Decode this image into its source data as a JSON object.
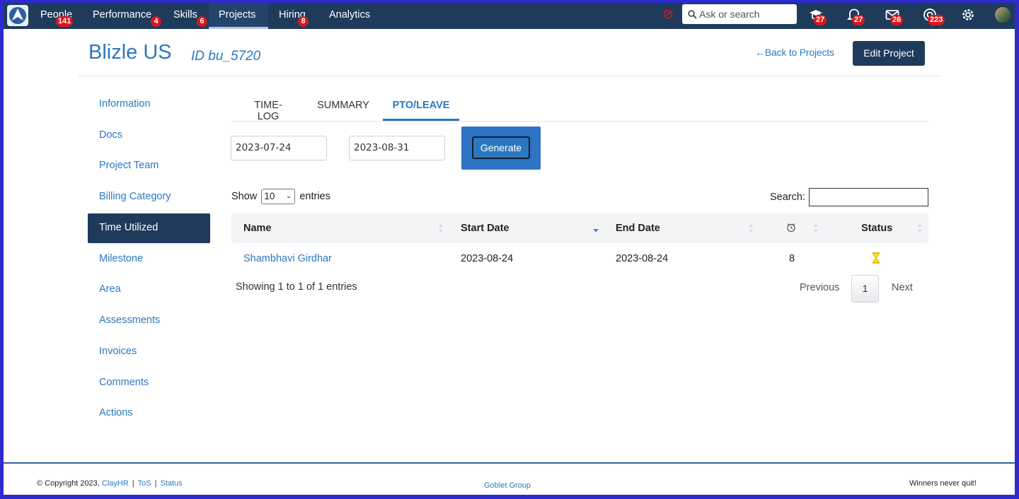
{
  "nav": {
    "items": [
      {
        "label": "People",
        "badge": "141"
      },
      {
        "label": "Performance",
        "badge": "4"
      },
      {
        "label": "Skills",
        "badge": "6"
      },
      {
        "label": "Projects",
        "badge": ""
      },
      {
        "label": "Hiring",
        "badge": "8"
      },
      {
        "label": "Analytics",
        "badge": ""
      }
    ],
    "search_placeholder": "Ask or search",
    "icons": [
      {
        "name": "graduation-cap-icon",
        "badge": "27"
      },
      {
        "name": "bell-icon",
        "badge": "27"
      },
      {
        "name": "mail-icon",
        "badge": "26"
      },
      {
        "name": "support-icon",
        "badge": "223"
      },
      {
        "name": "gear-icon",
        "badge": ""
      }
    ]
  },
  "header": {
    "title": "Blizle US",
    "id_text": "ID bu_5720",
    "back_link": "Back to Projects",
    "edit_button": "Edit Project"
  },
  "sidebar": {
    "items": [
      "Information",
      "Docs",
      "Project Team",
      "Billing Category",
      "Time Utilized",
      "Milestone",
      "Area",
      "Assessments",
      "Invoices",
      "Comments",
      "Actions"
    ],
    "active": "Time Utilized"
  },
  "tabs": {
    "items": [
      "TIME-LOG",
      "SUMMARY",
      "PTO/LEAVE"
    ],
    "active": "PTO/LEAVE"
  },
  "filters": {
    "start_date": "2023-07-24",
    "end_date": "2023-08-31",
    "generate_label": "Generate"
  },
  "table": {
    "show_label": "Show",
    "entries_label": "entries",
    "page_size": "10",
    "search_label": "Search:",
    "columns": [
      "Name",
      "Start Date",
      "End Date",
      "",
      "Status"
    ],
    "rows": [
      {
        "name": "Shambhavi Girdhar",
        "start": "2023-08-24",
        "end": "2023-08-24",
        "count": "8"
      }
    ],
    "showing": "Showing 1 to 1 of 1 entries",
    "prev": "Previous",
    "page": "1",
    "next": "Next"
  },
  "footer": {
    "copyright": "© Copyright 2023,",
    "brand": "ClayHR",
    "tos": "ToS",
    "status": "Status",
    "center": "Goblet Group",
    "right": "Winners never quit!"
  },
  "colors": {
    "navbar": "#1f3b5c",
    "accent": "#2c78c0",
    "badge": "#d9161d",
    "frame": "#2e2ad0"
  }
}
